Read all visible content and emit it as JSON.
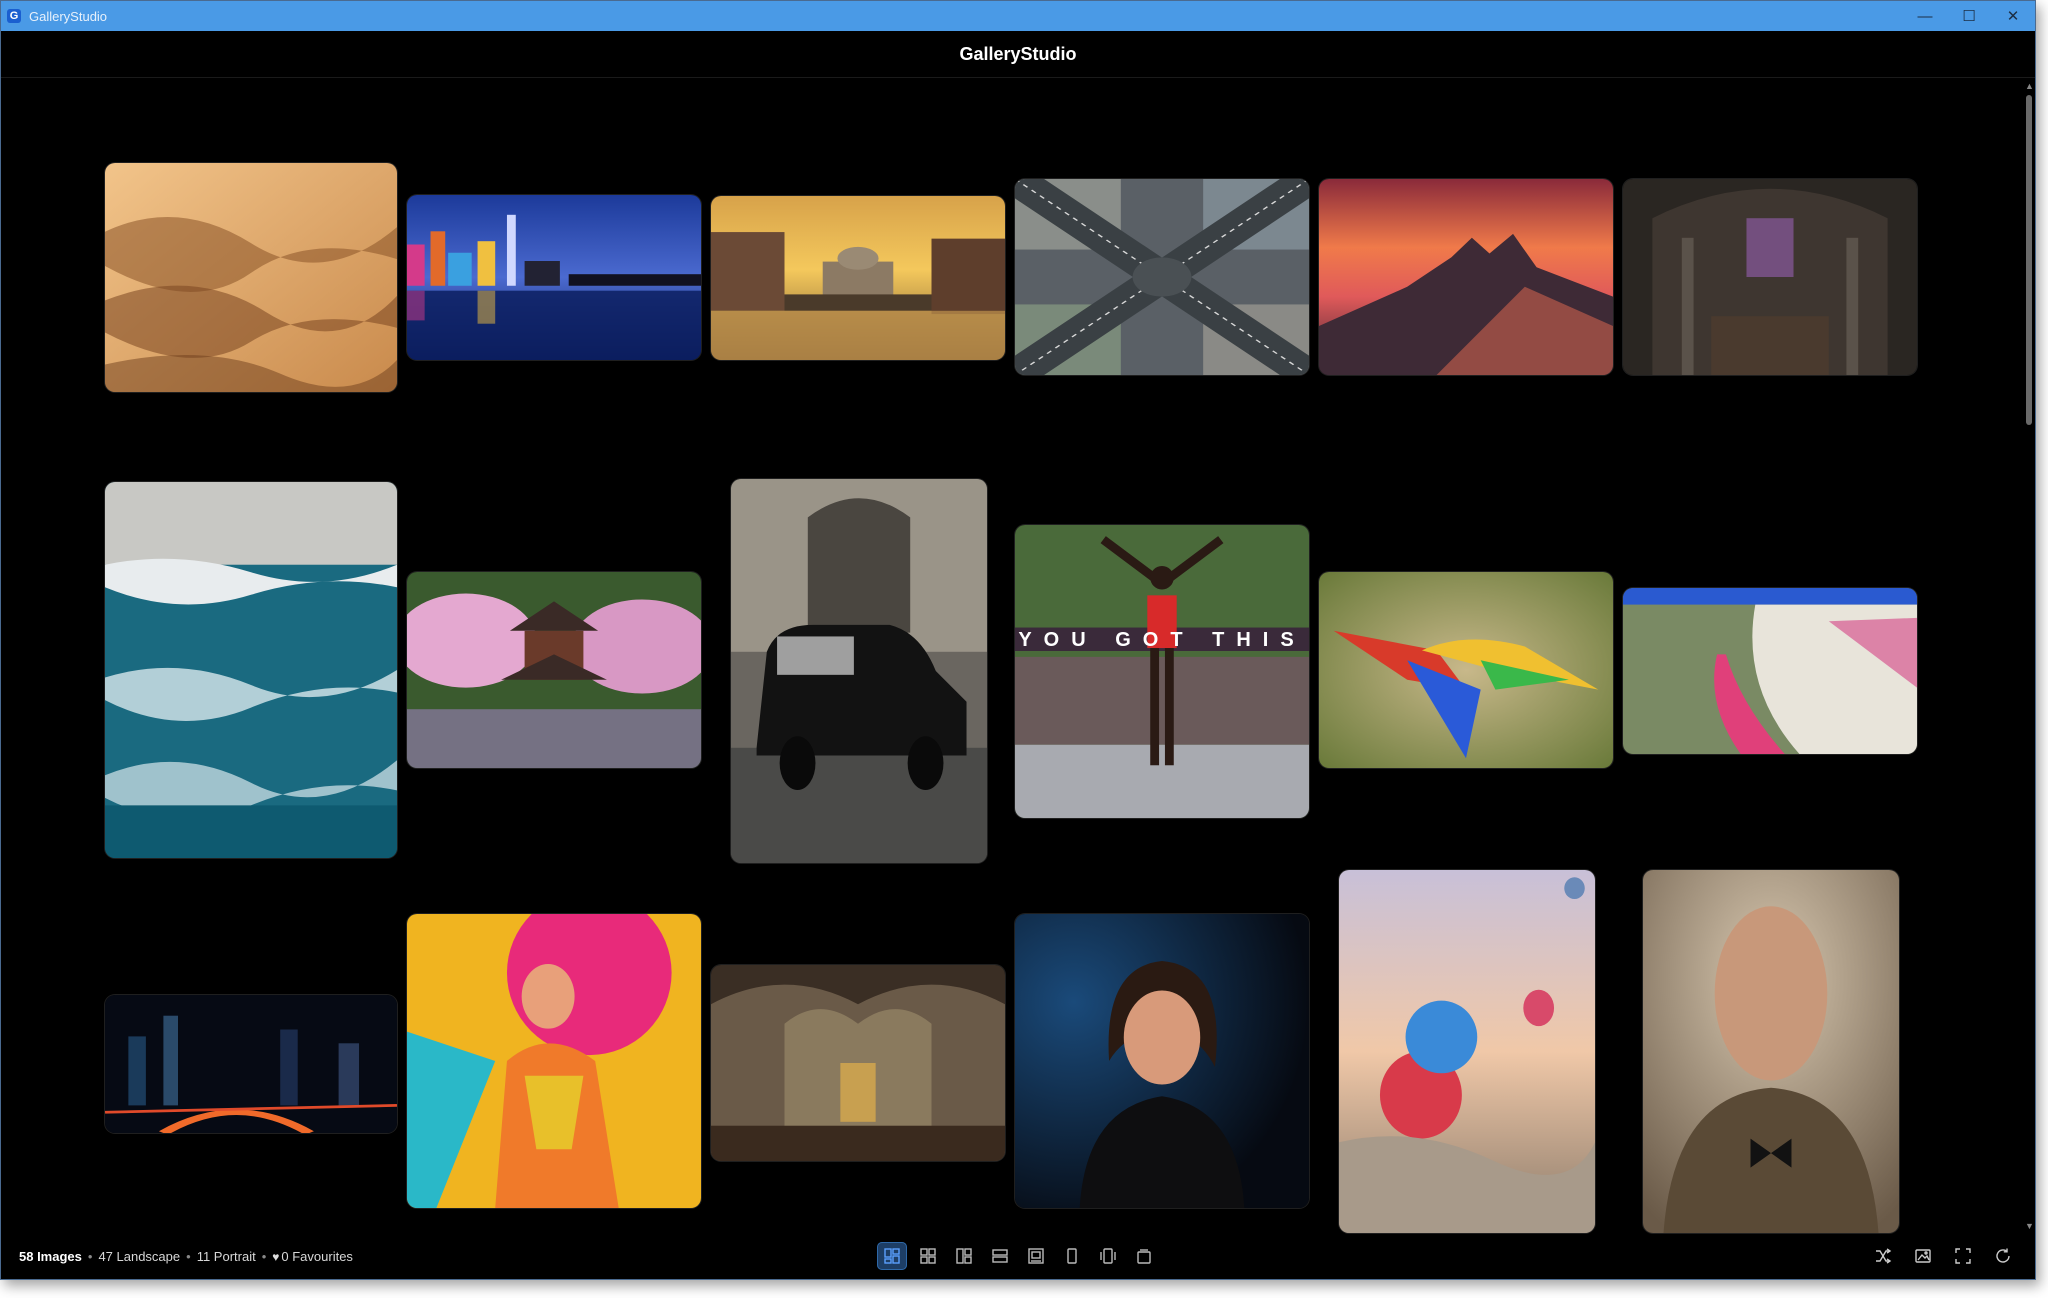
{
  "window": {
    "title": "GalleryStudio",
    "app_icon_letter": "G",
    "controls": {
      "minimize": "—",
      "maximize": "☐",
      "close": "✕"
    }
  },
  "header": {
    "title": "GalleryStudio"
  },
  "status": {
    "image_count": "58 Images",
    "landscape": "47 Landscape",
    "portrait": "11 Portrait",
    "favourites": "0 Favourites",
    "separator": "•"
  },
  "toolbar": {
    "view_modes": [
      "masonry-view-icon",
      "grid-view-icon",
      "mosaic-view-icon",
      "list-view-icon",
      "filmstrip-view-icon",
      "single-view-icon",
      "carousel-view-icon",
      "stack-view-icon"
    ],
    "active_view_index": 0,
    "actions": [
      "shuffle-icon",
      "slideshow-icon",
      "fullscreen-icon",
      "refresh-icon"
    ]
  },
  "gallery": {
    "images": [
      {
        "subject": "desert-dunes",
        "orientation": "landscape"
      },
      {
        "subject": "city-skyline-reflection",
        "orientation": "landscape"
      },
      {
        "subject": "venice-grand-canal",
        "orientation": "landscape"
      },
      {
        "subject": "aerial-intersection",
        "orientation": "landscape"
      },
      {
        "subject": "mountain-sunset",
        "orientation": "landscape"
      },
      {
        "subject": "cathedral-interior",
        "orientation": "landscape"
      },
      {
        "subject": "aerial-ocean-waves",
        "orientation": "portrait"
      },
      {
        "subject": "japanese-pagoda-blossoms",
        "orientation": "landscape"
      },
      {
        "subject": "vintage-car",
        "orientation": "portrait"
      },
      {
        "subject": "marathon-finish",
        "orientation": "landscape",
        "banner_text": "YOU GOT THIS"
      },
      {
        "subject": "macaw-flying",
        "orientation": "landscape"
      },
      {
        "subject": "pink-lake-aerial",
        "orientation": "landscape"
      },
      {
        "subject": "city-night-lights",
        "orientation": "landscape"
      },
      {
        "subject": "fashion-portrait",
        "orientation": "landscape"
      },
      {
        "subject": "gothic-cathedral-nave",
        "orientation": "landscape"
      },
      {
        "subject": "woman-portrait",
        "orientation": "landscape"
      },
      {
        "subject": "hot-air-balloons",
        "orientation": "portrait"
      },
      {
        "subject": "elderly-man-portrait",
        "orientation": "portrait"
      }
    ]
  }
}
